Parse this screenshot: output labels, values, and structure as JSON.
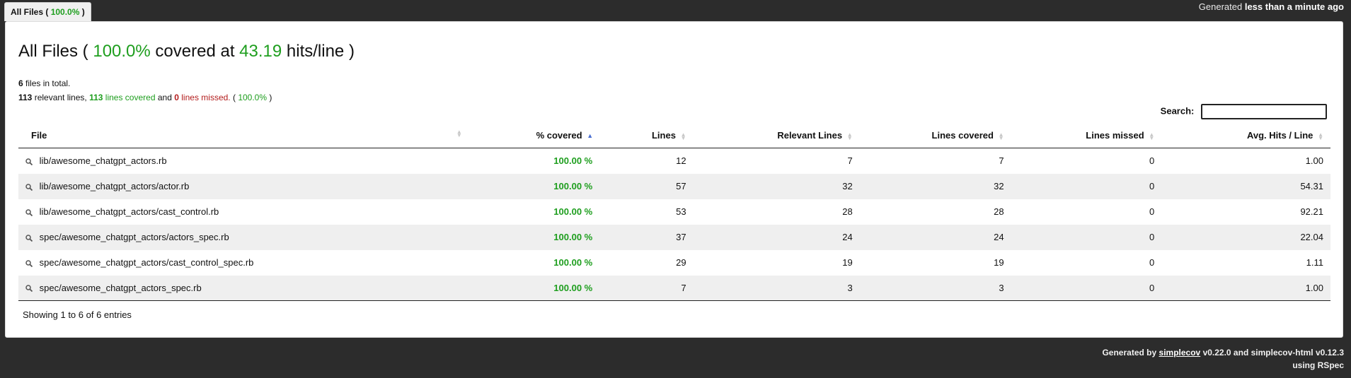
{
  "tab": {
    "label_prefix": "All Files (",
    "percent": "100.0%",
    "label_suffix": ")"
  },
  "generated_top": {
    "prefix": "Generated",
    "time": "less than a minute ago"
  },
  "title": {
    "prefix": "All Files (",
    "percent": "100.0%",
    "mid": "covered at",
    "hits": "43.19",
    "suffix": "hits/line )"
  },
  "summary": {
    "files_count": "6",
    "files_text": "files in total.",
    "relevant_count": "113",
    "relevant_text": "relevant lines,",
    "covered_count": "113",
    "covered_text": "lines covered",
    "and": "and",
    "missed_count": "0",
    "missed_text": "lines missed.",
    "percent_prefix": "(",
    "percent": "100.0%",
    "percent_suffix": ")"
  },
  "search": {
    "label": "Search:",
    "value": ""
  },
  "table": {
    "headers": [
      "File",
      "% covered",
      "Lines",
      "Relevant Lines",
      "Lines covered",
      "Lines missed",
      "Avg. Hits / Line"
    ],
    "rows": [
      {
        "file": "lib/awesome_chatgpt_actors.rb",
        "covered": "100.00 %",
        "lines": "12",
        "relevant": "7",
        "lines_covered": "7",
        "missed": "0",
        "avg": "1.00"
      },
      {
        "file": "lib/awesome_chatgpt_actors/actor.rb",
        "covered": "100.00 %",
        "lines": "57",
        "relevant": "32",
        "lines_covered": "32",
        "missed": "0",
        "avg": "54.31"
      },
      {
        "file": "lib/awesome_chatgpt_actors/cast_control.rb",
        "covered": "100.00 %",
        "lines": "53",
        "relevant": "28",
        "lines_covered": "28",
        "missed": "0",
        "avg": "92.21"
      },
      {
        "file": "spec/awesome_chatgpt_actors/actors_spec.rb",
        "covered": "100.00 %",
        "lines": "37",
        "relevant": "24",
        "lines_covered": "24",
        "missed": "0",
        "avg": "22.04"
      },
      {
        "file": "spec/awesome_chatgpt_actors/cast_control_spec.rb",
        "covered": "100.00 %",
        "lines": "29",
        "relevant": "19",
        "lines_covered": "19",
        "missed": "0",
        "avg": "1.11"
      },
      {
        "file": "spec/awesome_chatgpt_actors_spec.rb",
        "covered": "100.00 %",
        "lines": "7",
        "relevant": "3",
        "lines_covered": "3",
        "missed": "0",
        "avg": "1.00"
      }
    ]
  },
  "entries_info": "Showing 1 to 6 of 6 entries",
  "generated_bottom": {
    "prefix": "Generated by",
    "link": "simplecov",
    "version": "v0.22.0 and simplecov-html v0.12.3",
    "line2": "using RSpec"
  },
  "colors": {
    "covered": "#1e9e1e",
    "missed": "#b31d1d",
    "background": "#2c2c2c"
  }
}
